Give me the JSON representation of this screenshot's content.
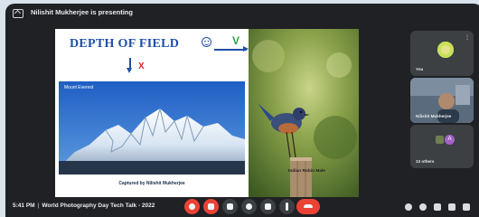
{
  "meeting": {
    "presenting_banner": "Nilishit Mukherjee is presenting",
    "time": "5:41 PM",
    "title": "World Photography Day Tech Talk - 2022"
  },
  "slide": {
    "title": "DEPTH OF FIELD",
    "check_symbol": "V",
    "cross_symbol": "X",
    "left_photo_label": "Mount Everest",
    "left_caption": "Captured by Nilishit Mukherjee",
    "right_photo_label": "Indian Robin Male"
  },
  "participants": [
    {
      "name": "You",
      "avatar_color": "#e6e08a"
    },
    {
      "name": "Nilishit Mukherjee",
      "active": true
    },
    {
      "name": "13 others",
      "avatar_letter": "A"
    }
  ],
  "controls": {
    "buttons": [
      "mic-off",
      "camera-off",
      "captions",
      "raise-hand",
      "present",
      "more"
    ],
    "end_call": "end-call",
    "right": [
      "info",
      "people",
      "chat",
      "activities",
      "host-controls"
    ]
  },
  "colors": {
    "accent_red": "#ea4335",
    "title_blue": "#1f4fa8",
    "active_border": "#8ab4f8"
  }
}
